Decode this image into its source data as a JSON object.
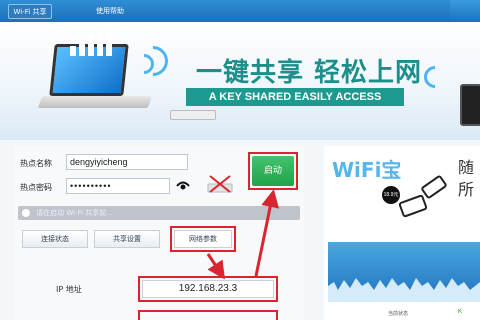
{
  "nav": {
    "tabs": [
      {
        "label": "Wi-Fi 共享",
        "active": true
      },
      {
        "label": "使用帮助",
        "active": false
      }
    ]
  },
  "banner": {
    "slogan": "一键共享 轻松上网",
    "sub_slogan": "A KEY SHARED EASILY ACCESS"
  },
  "form": {
    "ssid_label": "热点名称",
    "ssid_value": "dengyiyicheng",
    "password_label": "热点密码",
    "password_value": "••••••••••",
    "start_button": "启动",
    "notice": "请在启动 Wi-Fi 共享前..."
  },
  "subtabs": [
    {
      "label": "连接状态"
    },
    {
      "label": "共享设置"
    },
    {
      "label": "网络参数",
      "active": true
    }
  ],
  "network": {
    "ip_label": "IP 地址",
    "ip_value": "192.168.23.3"
  },
  "ad": {
    "logo": "WiFi宝",
    "side_line1": "随",
    "side_line2": "所",
    "badge": "18.9元"
  },
  "footer": {
    "status_text": "当前状态",
    "status_value": "K"
  },
  "colors": {
    "nav_blue": "#1d6fb8",
    "accent_red": "#d9252f",
    "start_green": "#21a34a",
    "slogan_teal": "#1d8e8a"
  }
}
